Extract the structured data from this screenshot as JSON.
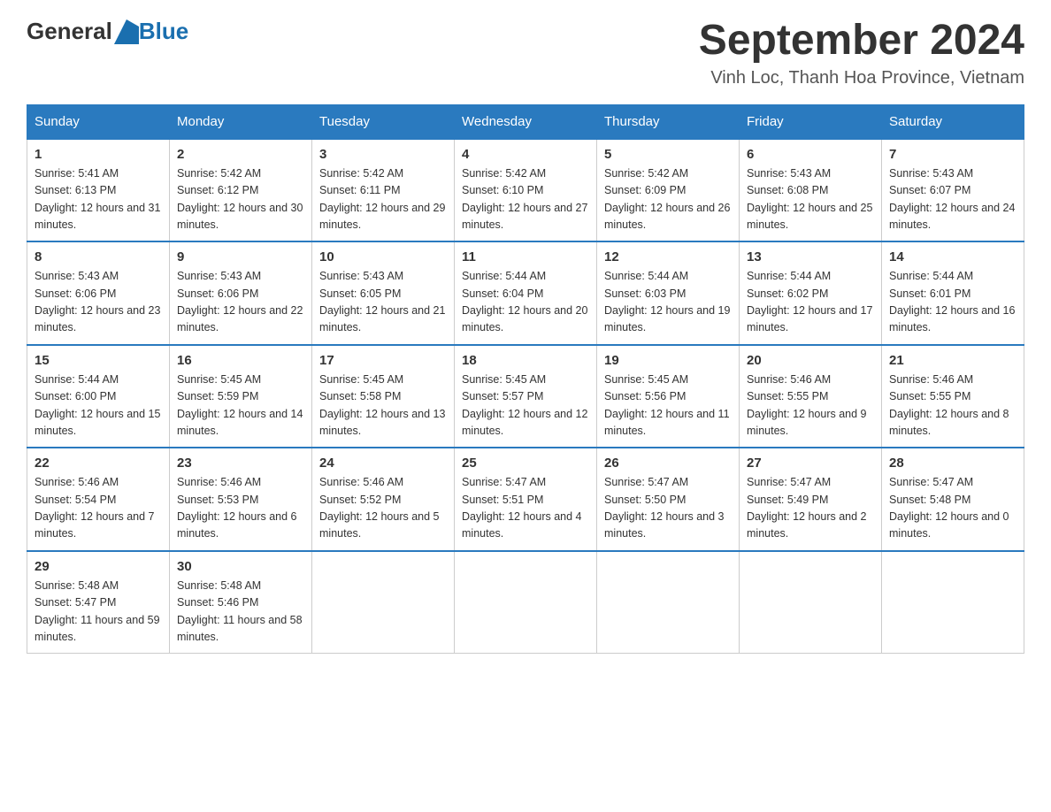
{
  "header": {
    "logo_general": "General",
    "logo_blue": "Blue",
    "title": "September 2024",
    "subtitle": "Vinh Loc, Thanh Hoa Province, Vietnam"
  },
  "columns": [
    "Sunday",
    "Monday",
    "Tuesday",
    "Wednesday",
    "Thursday",
    "Friday",
    "Saturday"
  ],
  "weeks": [
    [
      {
        "day": "1",
        "sunrise": "5:41 AM",
        "sunset": "6:13 PM",
        "daylight": "12 hours and 31 minutes."
      },
      {
        "day": "2",
        "sunrise": "5:42 AM",
        "sunset": "6:12 PM",
        "daylight": "12 hours and 30 minutes."
      },
      {
        "day": "3",
        "sunrise": "5:42 AM",
        "sunset": "6:11 PM",
        "daylight": "12 hours and 29 minutes."
      },
      {
        "day": "4",
        "sunrise": "5:42 AM",
        "sunset": "6:10 PM",
        "daylight": "12 hours and 27 minutes."
      },
      {
        "day": "5",
        "sunrise": "5:42 AM",
        "sunset": "6:09 PM",
        "daylight": "12 hours and 26 minutes."
      },
      {
        "day": "6",
        "sunrise": "5:43 AM",
        "sunset": "6:08 PM",
        "daylight": "12 hours and 25 minutes."
      },
      {
        "day": "7",
        "sunrise": "5:43 AM",
        "sunset": "6:07 PM",
        "daylight": "12 hours and 24 minutes."
      }
    ],
    [
      {
        "day": "8",
        "sunrise": "5:43 AM",
        "sunset": "6:06 PM",
        "daylight": "12 hours and 23 minutes."
      },
      {
        "day": "9",
        "sunrise": "5:43 AM",
        "sunset": "6:06 PM",
        "daylight": "12 hours and 22 minutes."
      },
      {
        "day": "10",
        "sunrise": "5:43 AM",
        "sunset": "6:05 PM",
        "daylight": "12 hours and 21 minutes."
      },
      {
        "day": "11",
        "sunrise": "5:44 AM",
        "sunset": "6:04 PM",
        "daylight": "12 hours and 20 minutes."
      },
      {
        "day": "12",
        "sunrise": "5:44 AM",
        "sunset": "6:03 PM",
        "daylight": "12 hours and 19 minutes."
      },
      {
        "day": "13",
        "sunrise": "5:44 AM",
        "sunset": "6:02 PM",
        "daylight": "12 hours and 17 minutes."
      },
      {
        "day": "14",
        "sunrise": "5:44 AM",
        "sunset": "6:01 PM",
        "daylight": "12 hours and 16 minutes."
      }
    ],
    [
      {
        "day": "15",
        "sunrise": "5:44 AM",
        "sunset": "6:00 PM",
        "daylight": "12 hours and 15 minutes."
      },
      {
        "day": "16",
        "sunrise": "5:45 AM",
        "sunset": "5:59 PM",
        "daylight": "12 hours and 14 minutes."
      },
      {
        "day": "17",
        "sunrise": "5:45 AM",
        "sunset": "5:58 PM",
        "daylight": "12 hours and 13 minutes."
      },
      {
        "day": "18",
        "sunrise": "5:45 AM",
        "sunset": "5:57 PM",
        "daylight": "12 hours and 12 minutes."
      },
      {
        "day": "19",
        "sunrise": "5:45 AM",
        "sunset": "5:56 PM",
        "daylight": "12 hours and 11 minutes."
      },
      {
        "day": "20",
        "sunrise": "5:46 AM",
        "sunset": "5:55 PM",
        "daylight": "12 hours and 9 minutes."
      },
      {
        "day": "21",
        "sunrise": "5:46 AM",
        "sunset": "5:55 PM",
        "daylight": "12 hours and 8 minutes."
      }
    ],
    [
      {
        "day": "22",
        "sunrise": "5:46 AM",
        "sunset": "5:54 PM",
        "daylight": "12 hours and 7 minutes."
      },
      {
        "day": "23",
        "sunrise": "5:46 AM",
        "sunset": "5:53 PM",
        "daylight": "12 hours and 6 minutes."
      },
      {
        "day": "24",
        "sunrise": "5:46 AM",
        "sunset": "5:52 PM",
        "daylight": "12 hours and 5 minutes."
      },
      {
        "day": "25",
        "sunrise": "5:47 AM",
        "sunset": "5:51 PM",
        "daylight": "12 hours and 4 minutes."
      },
      {
        "day": "26",
        "sunrise": "5:47 AM",
        "sunset": "5:50 PM",
        "daylight": "12 hours and 3 minutes."
      },
      {
        "day": "27",
        "sunrise": "5:47 AM",
        "sunset": "5:49 PM",
        "daylight": "12 hours and 2 minutes."
      },
      {
        "day": "28",
        "sunrise": "5:47 AM",
        "sunset": "5:48 PM",
        "daylight": "12 hours and 0 minutes."
      }
    ],
    [
      {
        "day": "29",
        "sunrise": "5:48 AM",
        "sunset": "5:47 PM",
        "daylight": "11 hours and 59 minutes."
      },
      {
        "day": "30",
        "sunrise": "5:48 AM",
        "sunset": "5:46 PM",
        "daylight": "11 hours and 58 minutes."
      },
      null,
      null,
      null,
      null,
      null
    ]
  ]
}
